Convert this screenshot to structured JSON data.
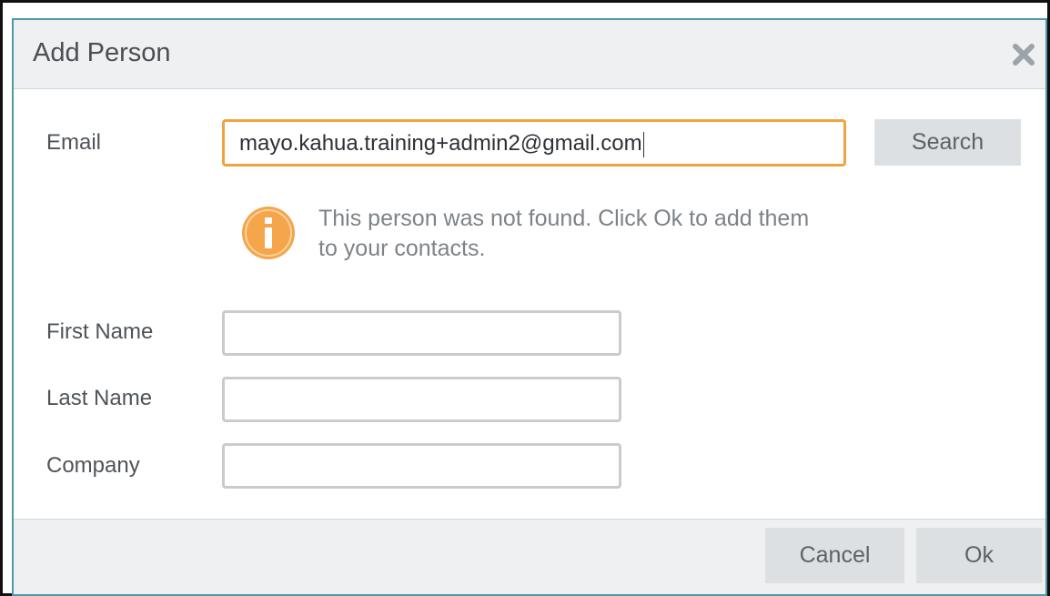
{
  "dialog": {
    "title": "Add Person",
    "close_icon": "close-x-icon"
  },
  "form": {
    "email": {
      "label": "Email",
      "value": "mayo.kahua.training+admin2@gmail.com"
    },
    "search_label": "Search",
    "notice": {
      "icon": "info-icon",
      "text": "This person was not found. Click Ok to add them to your contacts."
    },
    "first_name": {
      "label": "First Name",
      "value": ""
    },
    "last_name": {
      "label": "Last Name",
      "value": ""
    },
    "company": {
      "label": "Company",
      "value": ""
    }
  },
  "footer": {
    "cancel_label": "Cancel",
    "ok_label": "Ok"
  },
  "colors": {
    "dialog_border": "#4f98a8",
    "focus_border": "#f0a340",
    "info_icon": "#f5a54a",
    "button_bg": "#dde0e2",
    "header_bg": "#eef0f1"
  }
}
